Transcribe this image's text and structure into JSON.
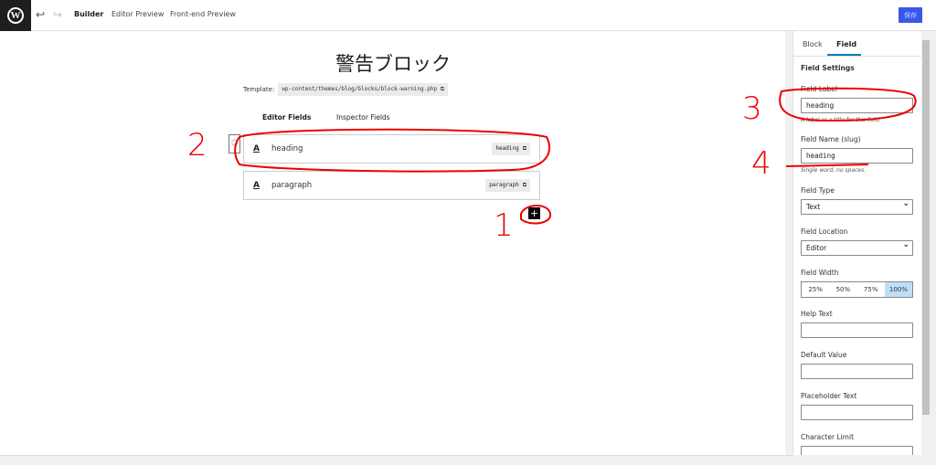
{
  "topbar": {
    "logo": "W",
    "undo_icon": "undo-icon",
    "redo_icon": "redo-icon",
    "tabs": [
      "Builder",
      "Editor Preview",
      "Front-end Preview"
    ],
    "active_tab": "Builder",
    "save_label": "保存",
    "save_color": "#3858e9"
  },
  "main": {
    "title": "警告ブロック",
    "template_label": "Template:",
    "template_path": "wp-content/themes/blog/blocks/block-warning.php",
    "tabs": [
      "Editor Fields",
      "Inspector Fields"
    ],
    "active_tab": "Editor Fields",
    "fields": [
      {
        "name": "heading",
        "slug": "heading",
        "icon": "A"
      },
      {
        "name": "paragraph",
        "slug": "paragraph",
        "icon": "A"
      }
    ],
    "add_label": "+"
  },
  "sidebar": {
    "tabs": [
      "Block",
      "Field"
    ],
    "active_tab": "Field",
    "section": "Field Settings",
    "field_label": {
      "label": "Field Label",
      "value": "heading",
      "hint": "A label or a title for this field."
    },
    "field_name": {
      "label": "Field Name (slug)",
      "value": "heading",
      "hint": "Single word, no spaces."
    },
    "field_type": {
      "label": "Field Type",
      "value": "Text"
    },
    "field_location": {
      "label": "Field Location",
      "value": "Editor"
    },
    "field_width": {
      "label": "Field Width",
      "options": [
        "25%",
        "50%",
        "75%",
        "100%"
      ],
      "selected": "100%"
    },
    "help_text": {
      "label": "Help Text",
      "value": ""
    },
    "default_value": {
      "label": "Default Value",
      "value": ""
    },
    "placeholder": {
      "label": "Placeholder Text",
      "value": ""
    },
    "char_limit": {
      "label": "Character Limit",
      "value": ""
    }
  },
  "annotations": {
    "color": "#e00000",
    "numbers": [
      "1",
      "2",
      "3",
      "4"
    ]
  }
}
